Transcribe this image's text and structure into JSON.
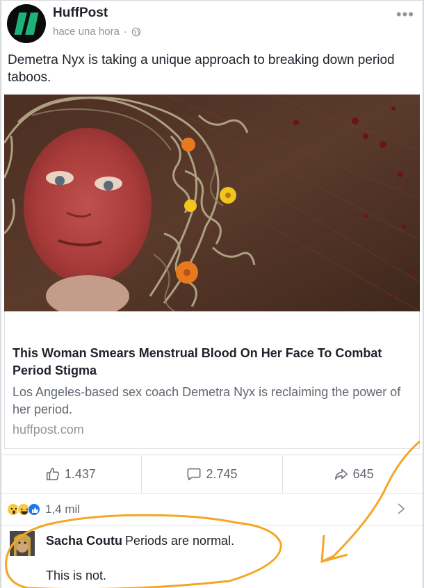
{
  "post": {
    "page_name": "HuffPost",
    "timestamp": "hace una hora",
    "separator": "·",
    "text": "Demetra Nyx is taking a unique approach to breaking down period taboos.",
    "more_icon": "more-options-icon",
    "privacy_icon": "globe-icon"
  },
  "link": {
    "title": "This Woman Smears Menstrual Blood On Her Face To Combat Period Stigma",
    "description": "Los Angeles-based sex coach Demetra Nyx is reclaiming the power of her period.",
    "domain": "huffpost.com"
  },
  "actions": [
    {
      "icon": "thumbs-up-icon",
      "count": "1.437"
    },
    {
      "icon": "comment-bubble-icon",
      "count": "2.745"
    },
    {
      "icon": "share-arrow-icon",
      "count": "645"
    }
  ],
  "reactions": {
    "icons": [
      "wow-emoji-icon",
      "haha-emoji-icon",
      "like-reaction-icon"
    ],
    "count": "1,4 mil"
  },
  "comment": {
    "author": "Sacha Coutu",
    "text": "Periods are normal.",
    "reply": "This is not."
  },
  "colors": {
    "annotation": "#f5a623",
    "text": "#1d2129",
    "muted": "#90949c",
    "brand": "#1fb17a"
  }
}
